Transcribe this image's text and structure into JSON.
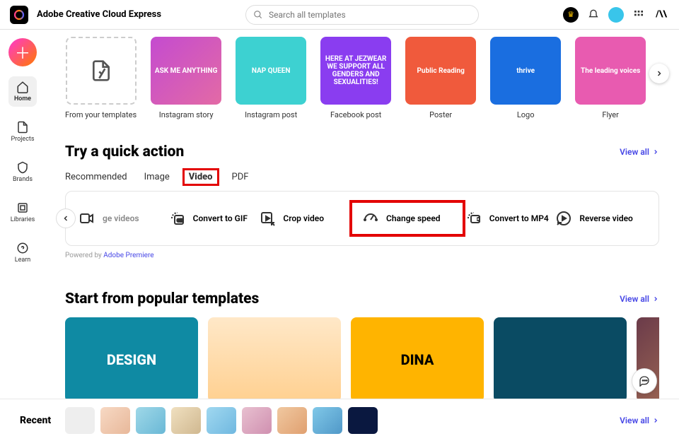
{
  "header": {
    "brand": "Adobe Creative Cloud Express",
    "search_placeholder": "Search all templates"
  },
  "sidebar": {
    "items": [
      {
        "label": "Home",
        "active": true
      },
      {
        "label": "Projects"
      },
      {
        "label": "Brands"
      },
      {
        "label": "Libraries"
      },
      {
        "label": "Learn"
      }
    ]
  },
  "templates": {
    "items": [
      {
        "label": "From your templates",
        "kind": "dashed"
      },
      {
        "label": "Instagram story",
        "bg": "linear-gradient(135deg,#c44bd0,#e36aa5)",
        "text": "ASK ME ANYTHING"
      },
      {
        "label": "Instagram post",
        "bg": "#3dd1d1",
        "text": "NAP QUEEN"
      },
      {
        "label": "Facebook post",
        "bg": "#8a3df0",
        "text": "HERE AT JEZWEAR WE SUPPORT ALL GENDERS AND SEXUALITIES!"
      },
      {
        "label": "Poster",
        "bg": "#f05a3c",
        "text": "Public Reading"
      },
      {
        "label": "Logo",
        "bg": "#1a6ee0",
        "text": "thrive"
      },
      {
        "label": "Flyer",
        "bg": "#e85bb0",
        "text": "The leading voices"
      }
    ]
  },
  "quick_actions": {
    "title": "Try a quick action",
    "view_all": "View all",
    "tabs": [
      "Recommended",
      "Image",
      "Video",
      "PDF"
    ],
    "active_tab": 2,
    "items": [
      {
        "label": "ge videos",
        "partial": true
      },
      {
        "label": "Convert to GIF"
      },
      {
        "label": "Crop video"
      },
      {
        "label": "Change speed",
        "highlighted": true
      },
      {
        "label": "Convert to MP4"
      },
      {
        "label": "Reverse video"
      }
    ],
    "powered_prefix": "Powered by ",
    "powered_link": "Adobe Premiere"
  },
  "popular": {
    "title": "Start from popular templates",
    "view_all": "View all",
    "cards": [
      {
        "text": "DESIGN",
        "bg": "#0f8aa3"
      },
      {
        "text": "",
        "bg": "linear-gradient(180deg,#ffe8c8,#ffd090)"
      },
      {
        "text": "DINA",
        "bg": "#ffb400",
        "color": "#000"
      },
      {
        "text": "",
        "bg": "#0a4b63"
      },
      {
        "text": "",
        "bg": "linear-gradient(135deg,#6b3b4a,#c48a5a)"
      }
    ]
  },
  "recent": {
    "title": "Recent",
    "view_all": "View all",
    "thumbs": [
      "#eee",
      "linear-gradient(135deg,#f7d9c4,#e8b89a)",
      "linear-gradient(135deg,#9fd8e8,#6ab8d6)",
      "linear-gradient(135deg,#f0e0c0,#d0b890)",
      "linear-gradient(135deg,#a0d8f0,#70b8e0)",
      "linear-gradient(135deg,#e8c0d0,#d090b0)",
      "linear-gradient(135deg,#f0c8a0,#e0a070)",
      "linear-gradient(135deg,#80c8e8,#5098c8)",
      "#0a1840"
    ]
  }
}
